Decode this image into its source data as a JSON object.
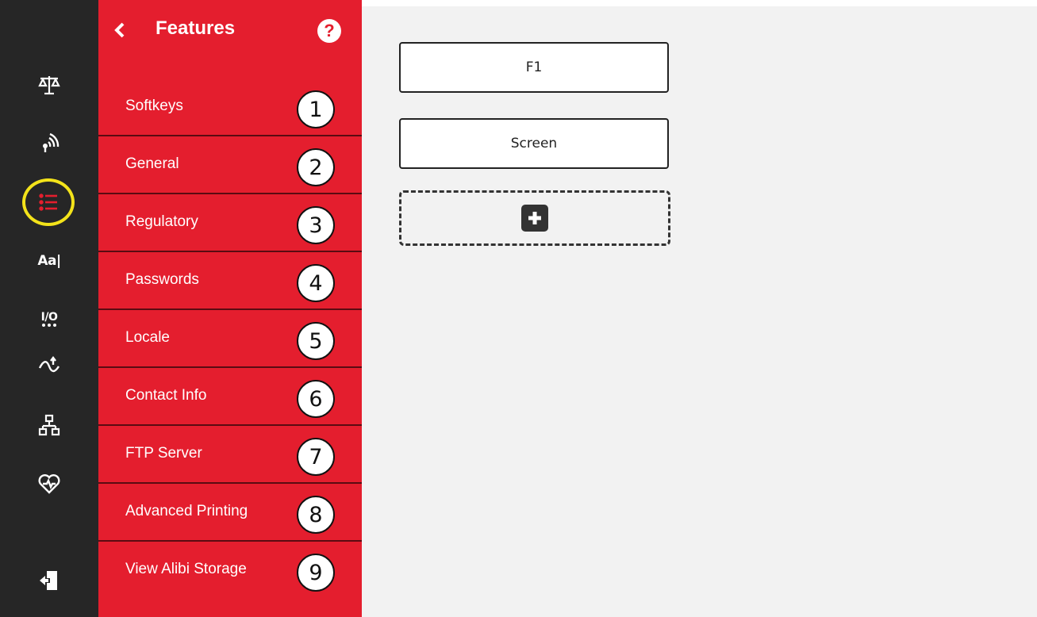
{
  "rail": {
    "icons": [
      "scale-icon",
      "wireless-icon",
      "features-list-icon",
      "text-format-icon",
      "io-icon",
      "transfer-icon",
      "network-icon",
      "health-icon",
      "logout-icon"
    ],
    "text_format_label": "Aa|",
    "io_label": "I/O",
    "highlight_color": "#f3e31a"
  },
  "panel": {
    "title": "Features",
    "help_label": "?",
    "accent_color": "#e41e2e",
    "items": [
      {
        "label": "Softkeys",
        "number": "1"
      },
      {
        "label": "General",
        "number": "2"
      },
      {
        "label": "Regulatory",
        "number": "3"
      },
      {
        "label": "Passwords",
        "number": "4"
      },
      {
        "label": "Locale",
        "number": "5"
      },
      {
        "label": "Contact Info",
        "number": "6"
      },
      {
        "label": "FTP Server",
        "number": "7"
      },
      {
        "label": "Advanced Printing",
        "number": "8"
      },
      {
        "label": "View Alibi Storage",
        "number": "9"
      }
    ]
  },
  "main": {
    "softkeys": [
      {
        "label": "F1"
      },
      {
        "label": "Screen"
      }
    ],
    "add_icon": "plus-icon"
  }
}
